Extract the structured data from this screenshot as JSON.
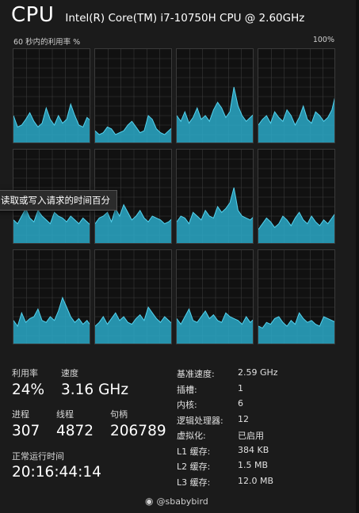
{
  "header": {
    "title": "CPU",
    "model": "Intel(R) Core(TM) i7-10750H CPU @ 2.60GHz"
  },
  "graph": {
    "left_label": "60 秒内的利用率 %",
    "right_label": "100%",
    "fill_color": "#2aa9c8",
    "line_color": "#54d2ee",
    "grid_color": "#3a3a3a",
    "cores": [
      [
        30,
        18,
        20,
        26,
        33,
        24,
        18,
        22,
        38,
        26,
        20,
        30,
        22,
        26,
        42,
        30,
        20,
        18,
        28,
        24
      ],
      [
        14,
        10,
        12,
        18,
        16,
        10,
        12,
        14,
        20,
        24,
        18,
        12,
        14,
        30,
        26,
        16,
        12,
        10,
        14,
        18
      ],
      [
        30,
        24,
        34,
        22,
        28,
        38,
        26,
        30,
        24,
        36,
        44,
        38,
        28,
        34,
        60,
        40,
        30,
        24,
        28,
        32
      ],
      [
        20,
        26,
        30,
        22,
        34,
        28,
        24,
        36,
        30,
        20,
        28,
        40,
        26,
        22,
        34,
        30,
        24,
        28,
        36,
        54
      ],
      [
        26,
        22,
        30,
        38,
        28,
        24,
        36,
        30,
        26,
        22,
        34,
        30,
        28,
        24,
        30,
        26,
        22,
        28,
        24,
        20
      ],
      [
        22,
        28,
        30,
        34,
        24,
        38,
        30,
        42,
        34,
        26,
        30,
        36,
        28,
        24,
        30,
        28,
        26,
        22,
        24,
        28
      ],
      [
        24,
        30,
        28,
        22,
        34,
        30,
        26,
        36,
        30,
        28,
        40,
        34,
        38,
        44,
        60,
        36,
        30,
        28,
        26,
        30
      ],
      [
        16,
        22,
        28,
        24,
        18,
        22,
        30,
        26,
        20,
        28,
        34,
        26,
        22,
        30,
        24,
        20,
        26,
        22,
        28,
        34
      ],
      [
        26,
        20,
        34,
        24,
        28,
        30,
        38,
        26,
        24,
        30,
        26,
        36,
        50,
        40,
        30,
        24,
        28,
        22,
        26,
        20
      ],
      [
        20,
        24,
        30,
        22,
        28,
        34,
        26,
        30,
        24,
        22,
        28,
        32,
        26,
        40,
        34,
        28,
        24,
        30,
        26,
        22
      ],
      [
        28,
        22,
        30,
        38,
        26,
        24,
        30,
        36,
        28,
        32,
        26,
        24,
        34,
        30,
        28,
        26,
        22,
        30,
        24,
        28
      ],
      [
        20,
        18,
        24,
        22,
        28,
        30,
        24,
        20,
        26,
        22,
        34,
        28,
        24,
        26,
        22,
        20,
        30,
        28,
        26,
        24
      ]
    ]
  },
  "tooltip": {
    "text": "读取或写入请求的时间百分"
  },
  "stats": {
    "utilization_label": "利用率",
    "utilization_value": "24%",
    "speed_label": "速度",
    "speed_value": "3.16 GHz",
    "processes_label": "进程",
    "processes_value": "307",
    "threads_label": "线程",
    "threads_value": "4872",
    "handles_label": "句柄",
    "handles_value": "206789",
    "uptime_label": "正常运行时间",
    "uptime_value": "20:16:44:14"
  },
  "specs": [
    {
      "label": "基准速度:",
      "value": "2.59 GHz"
    },
    {
      "label": "插槽:",
      "value": "1"
    },
    {
      "label": "内核:",
      "value": "6"
    },
    {
      "label": "逻辑处理器:",
      "value": "12"
    },
    {
      "label": "虚拟化:",
      "value": "已启用"
    },
    {
      "label": "L1 缓存:",
      "value": "384 KB"
    },
    {
      "label": "L2 缓存:",
      "value": "1.5 MB"
    },
    {
      "label": "L3 缓存:",
      "value": "12.0 MB"
    }
  ],
  "watermark": {
    "text": "@sbabybird",
    "icon": "weibo-icon"
  }
}
